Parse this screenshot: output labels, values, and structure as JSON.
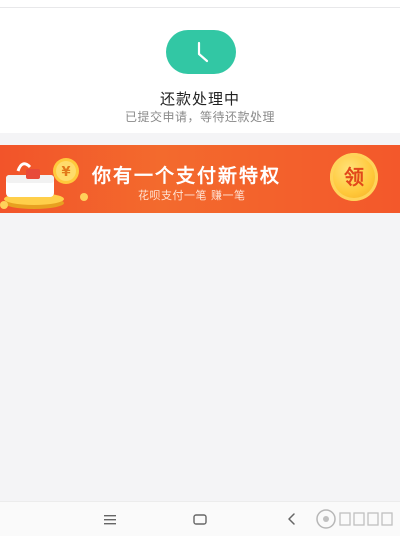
{
  "status": {
    "title": "还款处理中",
    "subtitle": "已提交申请，等待还款处理",
    "icon": "clock-icon",
    "accent_color": "#32c7a4"
  },
  "banner": {
    "title": "你有一个支付新特权",
    "subtitle": "花呗支付一笔 赚一笔",
    "claim_label": "领",
    "art_icon": "gift-coins-icon"
  },
  "nav": {
    "menu_icon": "menu-icon",
    "home_icon": "home-icon",
    "back_icon": "back-icon"
  }
}
